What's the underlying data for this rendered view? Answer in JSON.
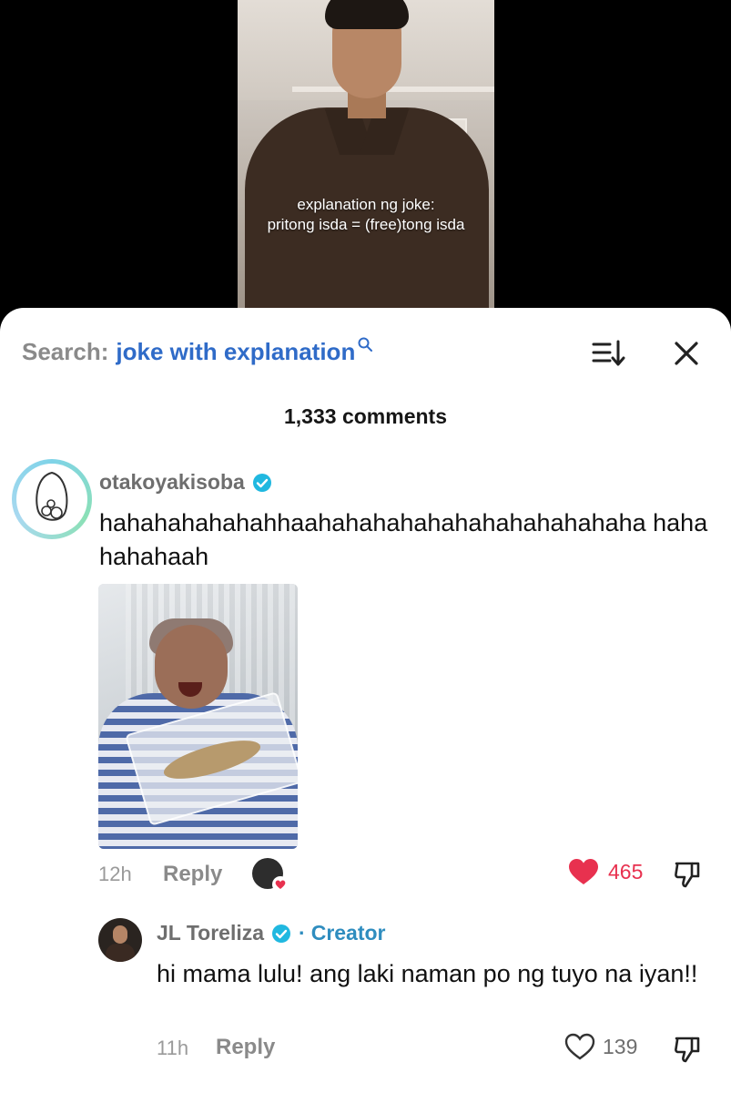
{
  "video": {
    "caption_line1": "explanation ng joke:",
    "caption_line2": "pritong isda = (free)tong isda"
  },
  "header": {
    "search_label": "Search:",
    "search_query": "joke with explanation",
    "sort_icon": "sort-icon",
    "close_icon": "close-icon"
  },
  "comments_count": "1,333 comments",
  "comment": {
    "username": "otakoyakisoba",
    "verified": true,
    "text": "hahahahahahahhaahahahahahahahahahahahaha hahahahahaah",
    "time": "12h",
    "reply_label": "Reply",
    "likes": "465",
    "liked": true
  },
  "reply": {
    "username": "JL Toreliza",
    "verified": true,
    "separator": "·",
    "badge": "Creator",
    "text": "hi mama lulu! ang laki naman po ng tuyo na iyan!!",
    "time": "11h",
    "reply_label": "Reply",
    "likes": "139",
    "liked": false
  },
  "colors": {
    "link_blue": "#2f6bc8",
    "creator_blue": "#2f8dbf",
    "like_red": "#e8314f",
    "verified_blue": "#20b8e0"
  }
}
